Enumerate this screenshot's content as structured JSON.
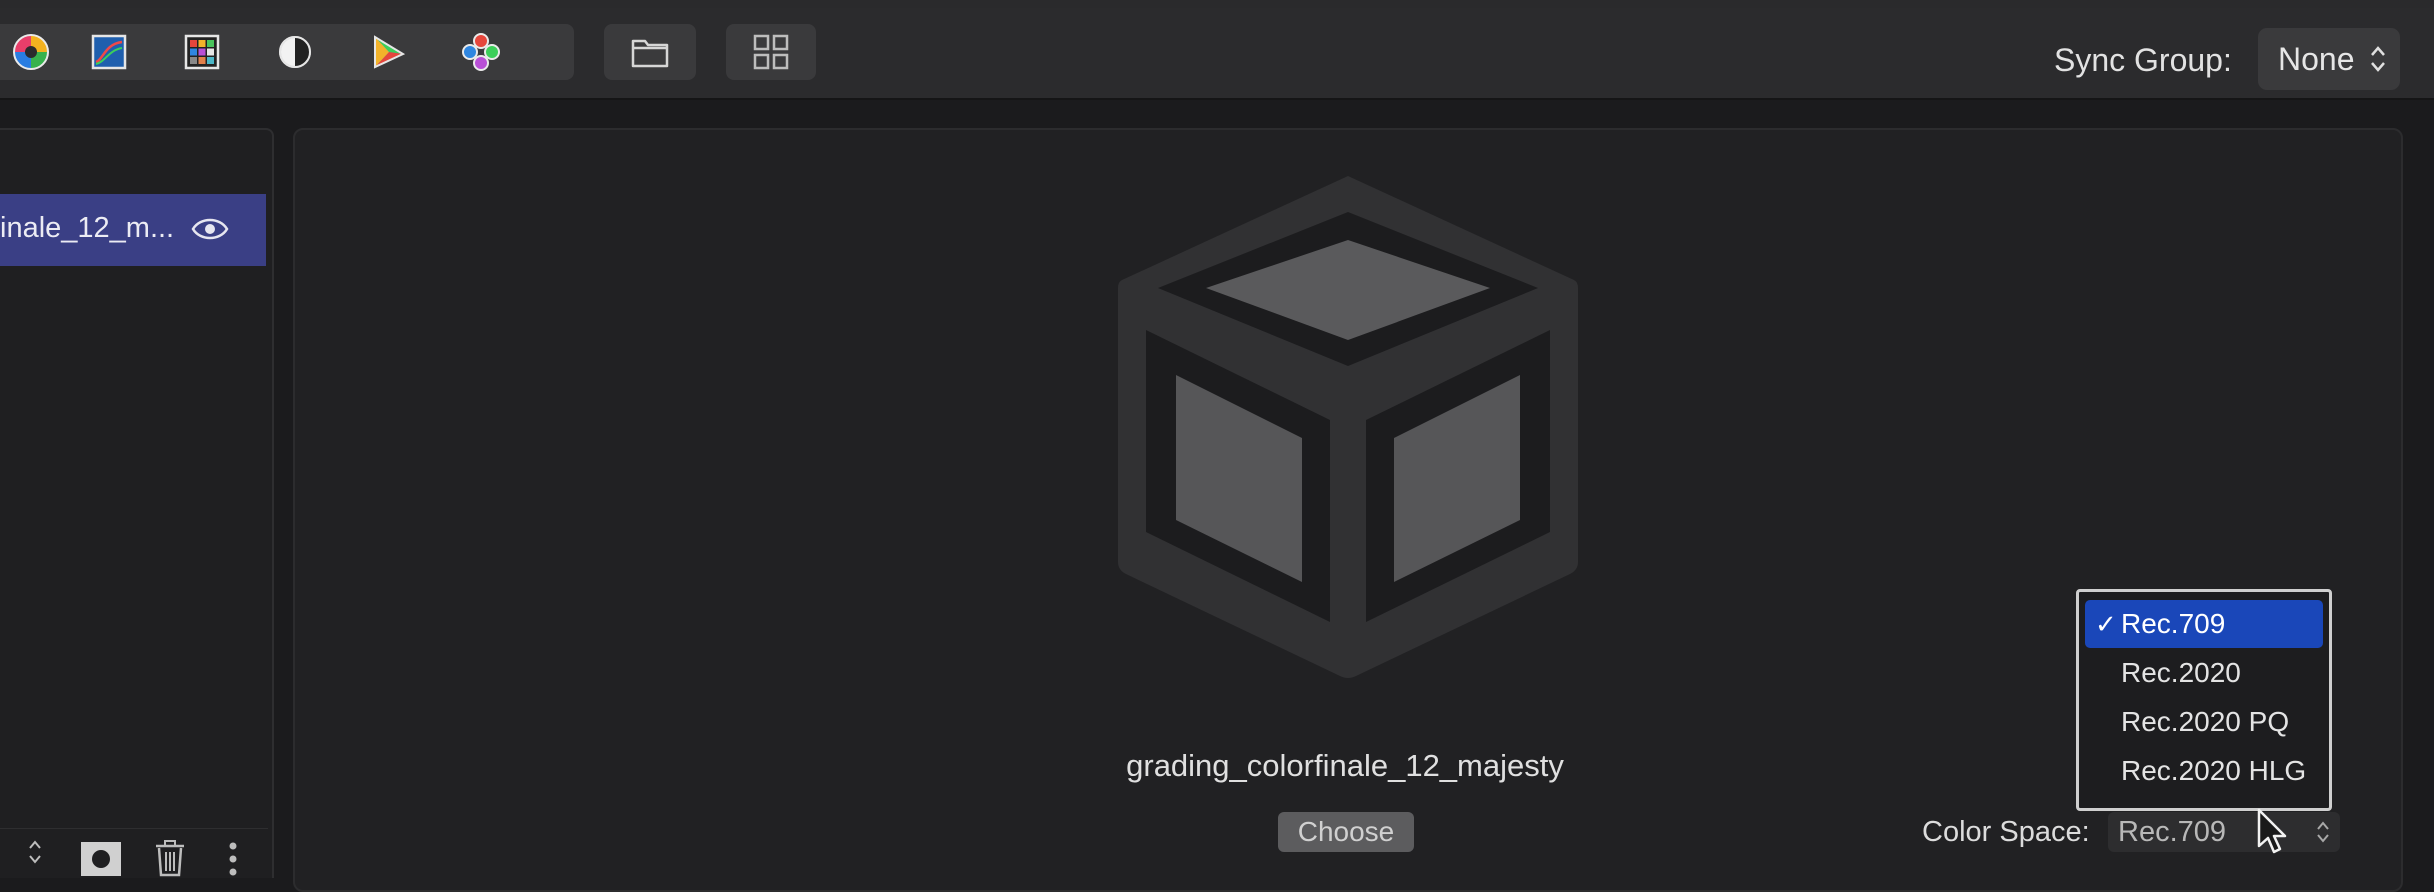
{
  "toolbar": {
    "tools": [
      {
        "icon": "color-wheel-icon"
      },
      {
        "icon": "color-curves-icon"
      },
      {
        "icon": "color-board-icon"
      },
      {
        "icon": "exposure-icon"
      },
      {
        "icon": "gamut-icon"
      },
      {
        "icon": "color-dots-icon"
      }
    ],
    "browser_icon": "folder-icon",
    "grid_icon": "grid-icon",
    "sync_group_label": "Sync Group:",
    "sync_group_value": "None"
  },
  "layers": {
    "items": [
      {
        "name": "inale_12_m...",
        "visible": true
      }
    ]
  },
  "preset": {
    "name": "grading_colorfinale_12_majesty",
    "choose_label": "Choose"
  },
  "color_space": {
    "label": "Color Space:",
    "value": "Rec.709",
    "options": [
      {
        "label": "Rec.709",
        "checked": true
      },
      {
        "label": "Rec.2020",
        "checked": false
      },
      {
        "label": "Rec.2020 PQ",
        "checked": false
      },
      {
        "label": "Rec.2020 HLG",
        "checked": false
      }
    ],
    "check_mark": "✓"
  },
  "colors": {
    "accent_selected": "#1a47b9",
    "layer_highlight": "#3a3f85"
  }
}
